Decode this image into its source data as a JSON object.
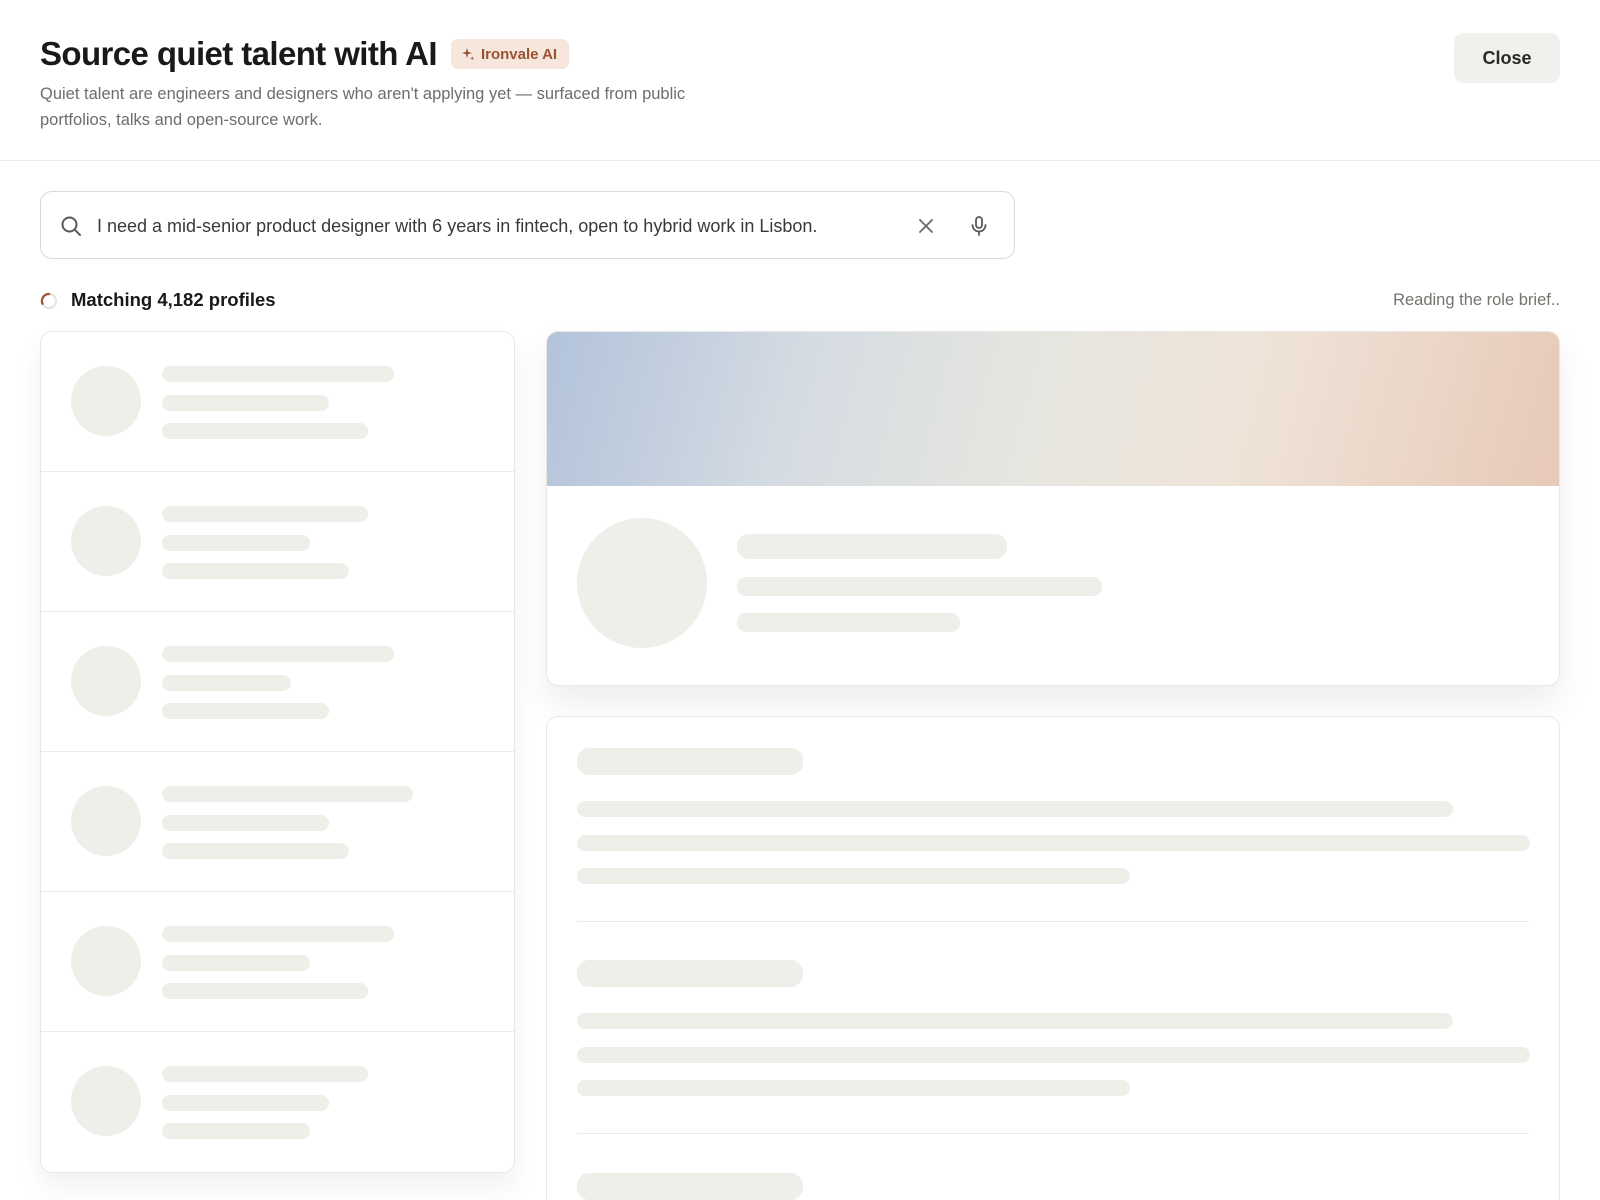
{
  "header": {
    "title": "Source quiet talent with AI",
    "badge": {
      "icon": "sparkle-icon",
      "label": "Ironvale AI"
    },
    "subtitle": "Quiet talent are engineers and designers who aren't applying yet — surfaced from public portfolios, talks and open-source work.",
    "close_label": "Close"
  },
  "search": {
    "value": "I need a mid-senior product designer with 6 years in fintech, open to hybrid work in Lisbon.",
    "icons": [
      "search-icon",
      "clear-icon",
      "microphone-icon"
    ]
  },
  "status": {
    "label": "Matching 4,182 profiles",
    "progress_text": "Reading the role brief.."
  },
  "colors": {
    "accent": "#9a5232",
    "badge_bg": "#f6e6dc",
    "skeleton": "#efeee9",
    "text": "#1a1917",
    "muted": "#6f6d68"
  }
}
